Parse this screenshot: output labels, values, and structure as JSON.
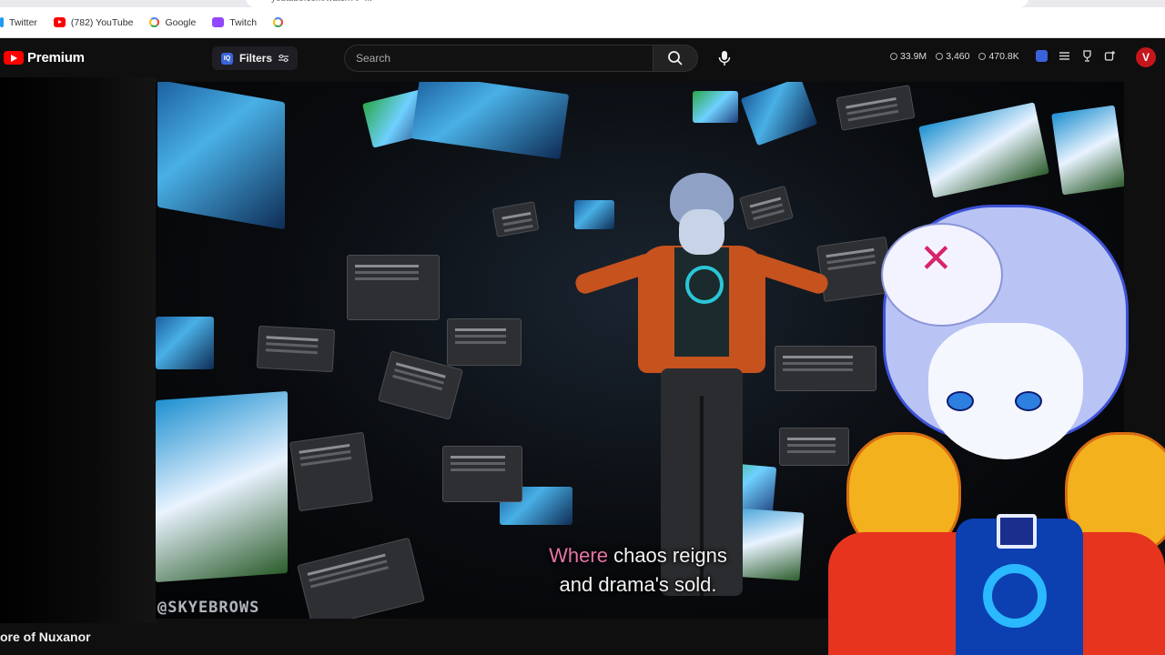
{
  "browser": {
    "address": "youtube.com/watch?v=...",
    "bookmarks": [
      {
        "label": "Twitter",
        "icon": "twitter-icon"
      },
      {
        "label": "(782) YouTube",
        "icon": "youtube-icon"
      },
      {
        "label": "Google",
        "icon": "google-icon"
      },
      {
        "label": "Twitch",
        "icon": "twitch-icon"
      }
    ]
  },
  "header": {
    "logo_text": "Premium",
    "filters_label": "Filters",
    "search_placeholder": "Search",
    "stats": [
      {
        "value": "33.9M",
        "icon": "clock-icon"
      },
      {
        "value": "3,460",
        "icon": "eye-icon"
      },
      {
        "value": "470.8K",
        "icon": "view-icon"
      }
    ],
    "avatar_letter": "V"
  },
  "video": {
    "caption_highlight": "Where",
    "caption_line1_rest": " chaos reigns",
    "caption_line2": "and drama's sold.",
    "watermark": "@SKYEBROWS"
  },
  "page": {
    "video_title_partial": "ore of Nuxanor"
  },
  "colors": {
    "brand_red": "#ff0000",
    "caption_highlight": "#e874a5",
    "background": "#0f0f0f"
  }
}
